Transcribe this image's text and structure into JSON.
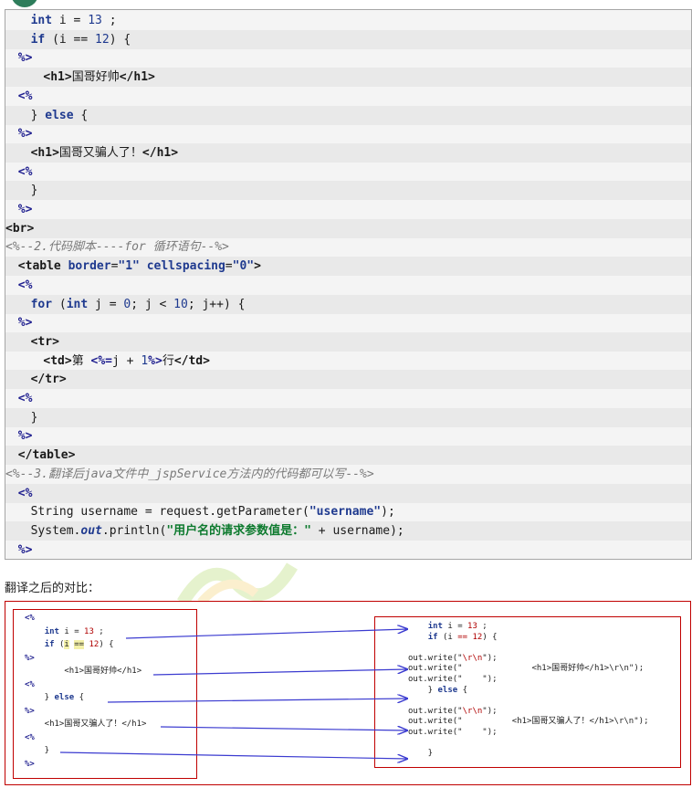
{
  "code_lines": [
    {
      "indent": 4,
      "parts": [
        {
          "t": "int",
          "c": "kw"
        },
        {
          "t": " i = "
        },
        {
          "t": "13",
          "c": "num"
        },
        {
          "t": " ;"
        }
      ]
    },
    {
      "indent": 4,
      "parts": [
        {
          "t": "if",
          "c": "kw"
        },
        {
          "t": " (i == "
        },
        {
          "t": "12",
          "c": "num"
        },
        {
          "t": ") {"
        }
      ]
    },
    {
      "indent": 2,
      "parts": [
        {
          "t": "%>",
          "c": "delim"
        }
      ]
    },
    {
      "indent": 6,
      "parts": [
        {
          "t": "<",
          "c": "tag"
        },
        {
          "t": "h1",
          "c": "tagname"
        },
        {
          "t": ">",
          "c": "tag"
        },
        {
          "t": "国哥好帅"
        },
        {
          "t": "</",
          "c": "tag"
        },
        {
          "t": "h1",
          "c": "tagname"
        },
        {
          "t": ">",
          "c": "tag"
        }
      ]
    },
    {
      "indent": 2,
      "parts": [
        {
          "t": "<%",
          "c": "delim"
        }
      ]
    },
    {
      "indent": 4,
      "parts": [
        {
          "t": "} "
        },
        {
          "t": "else",
          "c": "kw"
        },
        {
          "t": " {"
        }
      ]
    },
    {
      "indent": 2,
      "parts": [
        {
          "t": "%>",
          "c": "delim"
        }
      ]
    },
    {
      "indent": 4,
      "parts": [
        {
          "t": "<",
          "c": "tag"
        },
        {
          "t": "h1",
          "c": "tagname"
        },
        {
          "t": ">",
          "c": "tag"
        },
        {
          "t": "国哥又骗人了！"
        },
        {
          "t": "</",
          "c": "tag"
        },
        {
          "t": "h1",
          "c": "tagname"
        },
        {
          "t": ">",
          "c": "tag"
        }
      ]
    },
    {
      "indent": 2,
      "parts": [
        {
          "t": "<%",
          "c": "delim"
        }
      ]
    },
    {
      "indent": 4,
      "parts": [
        {
          "t": "}"
        }
      ]
    },
    {
      "indent": 2,
      "parts": [
        {
          "t": "%>",
          "c": "delim"
        }
      ]
    },
    {
      "indent": 0,
      "parts": [
        {
          "t": "<",
          "c": "tag"
        },
        {
          "t": "br",
          "c": "tagname"
        },
        {
          "t": ">",
          "c": "tag"
        }
      ]
    },
    {
      "indent": 0,
      "parts": [
        {
          "t": "<%--2.代码脚本----for 循环语句--%>",
          "c": "comment"
        }
      ]
    },
    {
      "indent": 2,
      "parts": [
        {
          "t": "<",
          "c": "tag"
        },
        {
          "t": "table",
          "c": "tagname"
        },
        {
          "t": " "
        },
        {
          "t": "border",
          "c": "attr"
        },
        {
          "t": "="
        },
        {
          "t": "\"1\"",
          "c": "str"
        },
        {
          "t": " "
        },
        {
          "t": "cellspacing",
          "c": "attr"
        },
        {
          "t": "="
        },
        {
          "t": "\"0\"",
          "c": "str"
        },
        {
          "t": ">",
          "c": "tag"
        }
      ]
    },
    {
      "indent": 2,
      "parts": [
        {
          "t": "<%",
          "c": "delim"
        }
      ]
    },
    {
      "indent": 4,
      "parts": [
        {
          "t": "for",
          "c": "kw"
        },
        {
          "t": " ("
        },
        {
          "t": "int",
          "c": "kw"
        },
        {
          "t": " j = "
        },
        {
          "t": "0",
          "c": "num"
        },
        {
          "t": "; j < "
        },
        {
          "t": "10",
          "c": "num"
        },
        {
          "t": "; j++) {"
        }
      ]
    },
    {
      "indent": 2,
      "parts": [
        {
          "t": "%>",
          "c": "delim"
        }
      ]
    },
    {
      "indent": 4,
      "parts": [
        {
          "t": "<",
          "c": "tag"
        },
        {
          "t": "tr",
          "c": "tagname"
        },
        {
          "t": ">",
          "c": "tag"
        }
      ]
    },
    {
      "indent": 6,
      "parts": [
        {
          "t": "<",
          "c": "tag"
        },
        {
          "t": "td",
          "c": "tagname"
        },
        {
          "t": ">",
          "c": "tag"
        },
        {
          "t": "第 "
        },
        {
          "t": "<%=",
          "c": "delim"
        },
        {
          "t": "j + "
        },
        {
          "t": "1",
          "c": "num"
        },
        {
          "t": "%>",
          "c": "delim"
        },
        {
          "t": "行"
        },
        {
          "t": "</",
          "c": "tag"
        },
        {
          "t": "td",
          "c": "tagname"
        },
        {
          "t": ">",
          "c": "tag"
        }
      ]
    },
    {
      "indent": 4,
      "parts": [
        {
          "t": "</",
          "c": "tag"
        },
        {
          "t": "tr",
          "c": "tagname"
        },
        {
          "t": ">",
          "c": "tag"
        }
      ]
    },
    {
      "indent": 2,
      "parts": [
        {
          "t": "<%",
          "c": "delim"
        }
      ]
    },
    {
      "indent": 4,
      "parts": [
        {
          "t": "}"
        }
      ]
    },
    {
      "indent": 2,
      "parts": [
        {
          "t": "%>",
          "c": "delim"
        }
      ]
    },
    {
      "indent": 2,
      "parts": [
        {
          "t": "</",
          "c": "tag"
        },
        {
          "t": "table",
          "c": "tagname"
        },
        {
          "t": ">",
          "c": "tag"
        }
      ]
    },
    {
      "indent": 0,
      "parts": [
        {
          "t": "<%--3.翻译后java文件中_jspService方法内的代码都可以写--%>",
          "c": "comment"
        }
      ]
    },
    {
      "indent": 2,
      "parts": [
        {
          "t": "<%",
          "c": "delim"
        }
      ]
    },
    {
      "indent": 4,
      "parts": [
        {
          "t": "String username = request.getParameter("
        },
        {
          "t": "\"username\"",
          "c": "str"
        },
        {
          "t": ");"
        }
      ]
    },
    {
      "indent": 4,
      "parts": [
        {
          "t": "System."
        },
        {
          "t": "out",
          "c": "out"
        },
        {
          "t": ".println("
        },
        {
          "t": "\"用户名的请求参数值是：\"",
          "c": "str-green"
        },
        {
          "t": " + username);"
        }
      ]
    },
    {
      "indent": 2,
      "parts": [
        {
          "t": "%>",
          "c": "delim"
        }
      ]
    }
  ],
  "caption": "翻译之后的对比：",
  "left_panel_lines": [
    [
      {
        "t": "<%",
        "c": "small-delim"
      }
    ],
    [
      {
        "t": "    "
      },
      {
        "t": "int",
        "c": "small-kw"
      },
      {
        "t": " i = "
      },
      {
        "t": "13",
        "c": "small-num"
      },
      {
        "t": " ;"
      }
    ],
    [
      {
        "t": "    "
      },
      {
        "t": "if",
        "c": "small-kw"
      },
      {
        "t": " ("
      },
      {
        "t": "i",
        "c": "small-hl"
      },
      {
        "t": " "
      },
      {
        "t": "==",
        "c": "small-hl"
      },
      {
        "t": " "
      },
      {
        "t": "12",
        "c": "small-num"
      },
      {
        "t": ") {"
      }
    ],
    [
      {
        "t": "%>",
        "c": "small-delim"
      }
    ],
    [
      {
        "t": "        <h1>国哥好帅</h1>"
      }
    ],
    [
      {
        "t": "<%",
        "c": "small-delim"
      }
    ],
    [
      {
        "t": "    } "
      },
      {
        "t": "else",
        "c": "small-kw"
      },
      {
        "t": " {"
      }
    ],
    [
      {
        "t": "%>",
        "c": "small-delim"
      }
    ],
    [
      {
        "t": "    <h1>国哥又骗人了！</h1>"
      }
    ],
    [
      {
        "t": "<%",
        "c": "small-delim"
      }
    ],
    [
      {
        "t": "    }"
      }
    ],
    [
      {
        "t": "%>",
        "c": "small-delim"
      }
    ]
  ],
  "right_panel_lines": [
    [
      {
        "t": "    "
      },
      {
        "t": "int",
        "c": "small-kw"
      },
      {
        "t": " i = "
      },
      {
        "t": "13",
        "c": "small-num"
      },
      {
        "t": " ;"
      }
    ],
    [
      {
        "t": "    "
      },
      {
        "t": "if",
        "c": "small-kw"
      },
      {
        "t": " (i "
      },
      {
        "t": "==",
        "c": "small-num"
      },
      {
        "t": " "
      },
      {
        "t": "12",
        "c": "small-num"
      },
      {
        "t": ") {"
      }
    ],
    [
      {
        "t": ""
      }
    ],
    [
      {
        "t": "out.write(\""
      },
      {
        "t": "\\r\\n",
        "c": "small-strpart"
      },
      {
        "t": "\");"
      }
    ],
    [
      {
        "t": "out.write(\"              <h1>国哥好帅</h1>\\r\\n\");"
      }
    ],
    [
      {
        "t": "out.write(\"    \");"
      }
    ],
    [
      {
        "t": "    } "
      },
      {
        "t": "else",
        "c": "small-kw"
      },
      {
        "t": " {"
      }
    ],
    [
      {
        "t": ""
      }
    ],
    [
      {
        "t": "out.write(\""
      },
      {
        "t": "\\r\\n",
        "c": "small-strpart"
      },
      {
        "t": "\");"
      }
    ],
    [
      {
        "t": "out.write(\"          <h1>国哥又骗人了！</h1>\\r\\n\");"
      }
    ],
    [
      {
        "t": "out.write(\"    \");"
      }
    ],
    [
      {
        "t": ""
      }
    ],
    [
      {
        "t": "    }"
      }
    ]
  ]
}
